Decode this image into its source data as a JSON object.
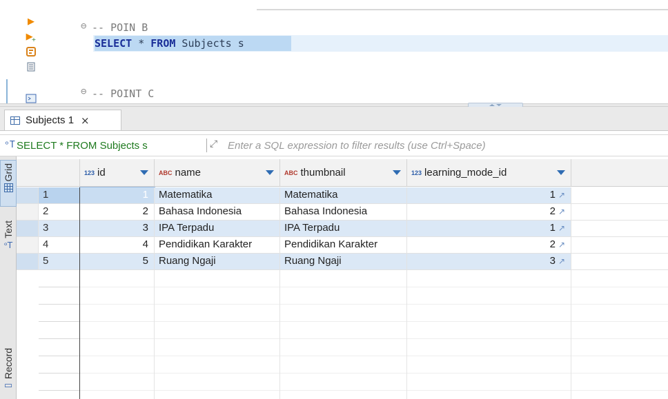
{
  "editor": {
    "comment_b": "-- POIN B",
    "sql_select": "SELECT",
    "sql_star": " * ",
    "sql_from": "FROM",
    "sql_rest": " Subjects s",
    "comment_c": "-- POINT C",
    "gutter_icons": [
      "execute-statement-icon",
      "execute-script-icon",
      "explain-plan-icon",
      "load-script-icon",
      "terminal-icon"
    ]
  },
  "results_tab": {
    "label": "Subjects 1",
    "close": "×"
  },
  "filter": {
    "query": "SELECT * FROM Subjects s",
    "placeholder": "Enter a SQL expression to filter results (use Ctrl+Space)"
  },
  "side_tabs": {
    "grid": "Grid",
    "text": "Text",
    "record": "Record"
  },
  "grid": {
    "columns": [
      {
        "type_icon": "123",
        "name": "id"
      },
      {
        "type_icon": "ABC",
        "name": "name"
      },
      {
        "type_icon": "ABC",
        "name": "thumbnail"
      },
      {
        "type_icon": "123",
        "name": "learning_mode_id"
      }
    ],
    "rows": [
      {
        "rownum": "1",
        "id": "1",
        "name": "Matematika",
        "thumbnail": "Matematika",
        "learning_mode_id": "1"
      },
      {
        "rownum": "2",
        "id": "2",
        "name": "Bahasa Indonesia",
        "thumbnail": "Bahasa Indonesia",
        "learning_mode_id": "2"
      },
      {
        "rownum": "3",
        "id": "3",
        "name": "IPA Terpadu",
        "thumbnail": "IPA Terpadu",
        "learning_mode_id": "1"
      },
      {
        "rownum": "4",
        "id": "4",
        "name": "Pendidikan Karakter",
        "thumbnail": "Pendidikan Karakter",
        "learning_mode_id": "2"
      },
      {
        "rownum": "5",
        "id": "5",
        "name": "Ruang Ngaji",
        "thumbnail": "Ruang Ngaji",
        "learning_mode_id": "3"
      }
    ],
    "selected_row": 1
  },
  "colors": {
    "keyword": "#1a2e98",
    "selection": "#bcd9f3",
    "row_highlight": "#dbe8f6",
    "filter_query": "#1e7a1e"
  }
}
